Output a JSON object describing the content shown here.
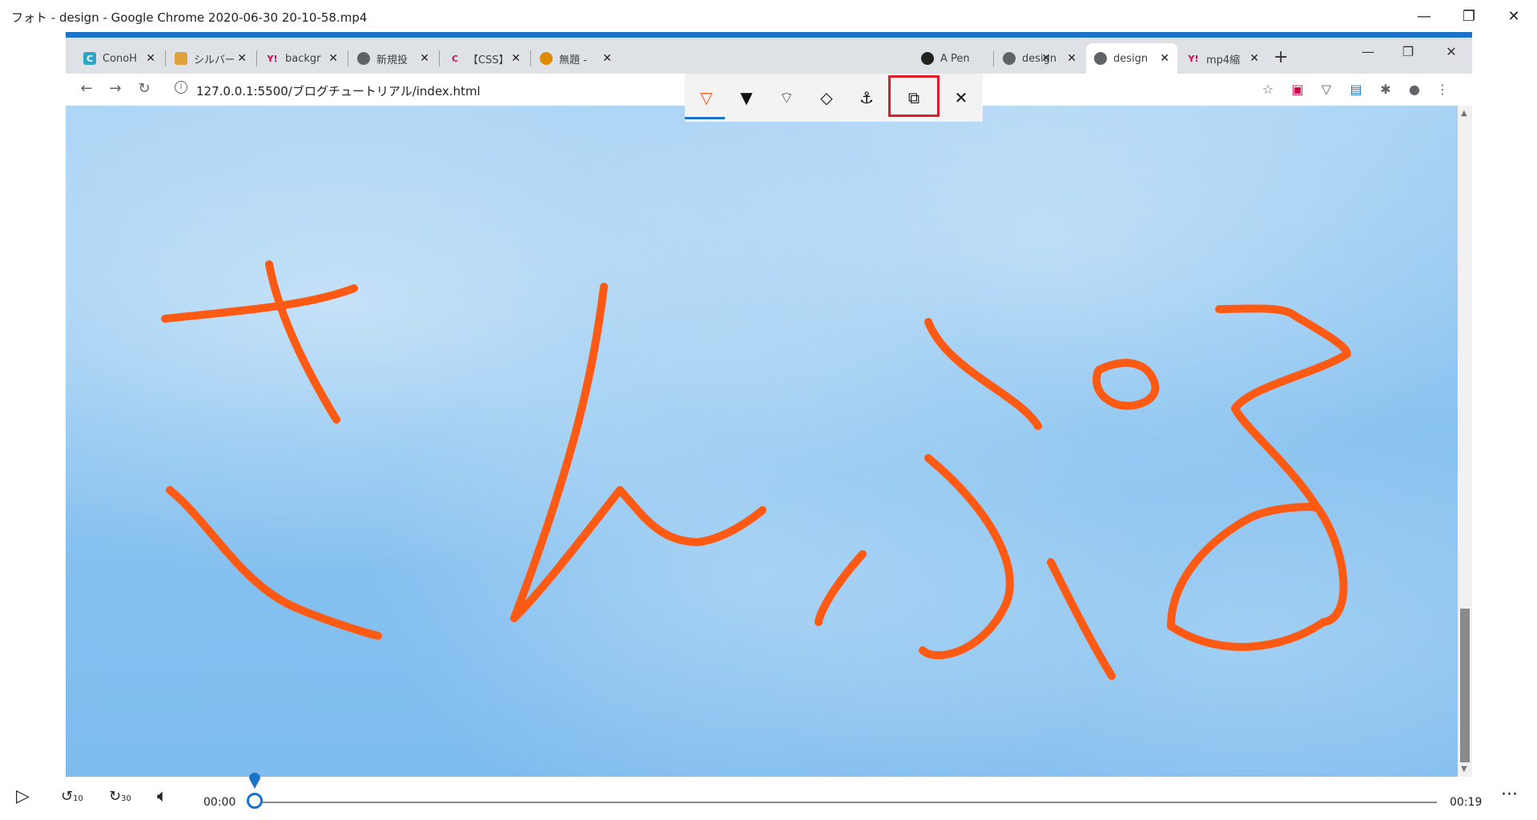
{
  "player": {
    "title": "フォト - design - Google Chrome 2020-06-30 20-10-58.mp4",
    "minimize_glyph": "—",
    "restore_glyph": "❐",
    "close_glyph": "✕"
  },
  "browser": {
    "tabs": [
      {
        "label": "ConoH",
        "favicon": "C",
        "favicon_color": "#2aa6c9"
      },
      {
        "label": "シルバー",
        "favicon": "",
        "favicon_color": "#e0a23a"
      },
      {
        "label": "backgr",
        "favicon": "Y!",
        "favicon_color": "#d6004c"
      },
      {
        "label": "新規投",
        "favicon": "",
        "favicon_color": "#5f6368"
      },
      {
        "label": "【CSS】",
        "favicon": "C",
        "favicon_color": "#c2185b"
      },
      {
        "label": "無題 -",
        "favicon": "",
        "favicon_color": "#e08a00"
      },
      {
        "label": "A Pen",
        "favicon": "",
        "favicon_color": "#222"
      },
      {
        "label": "design",
        "favicon": "",
        "favicon_color": "#5f6368"
      },
      {
        "label": "design",
        "favicon": "",
        "favicon_color": "#5f6368",
        "active": true
      },
      {
        "label": "mp4縮",
        "favicon": "Y!",
        "favicon_color": "#d6004c"
      }
    ],
    "new_tab_glyph": "+",
    "url": "127.0.0.1:5500/ブログチュートリアル/index.html",
    "accent_color": "#1a73c9"
  },
  "ink_toolbar": {
    "tools": [
      {
        "name": "ballpoint-pen",
        "glyph": "▽"
      },
      {
        "name": "pencil",
        "glyph": "▼"
      },
      {
        "name": "calligraphy-pen",
        "glyph": "⌔"
      },
      {
        "name": "eraser",
        "glyph": "◇"
      },
      {
        "name": "anchor",
        "glyph": "⚓"
      },
      {
        "name": "save",
        "glyph": "⧉"
      },
      {
        "name": "close",
        "glyph": "✕"
      }
    ],
    "highlight_color": "#e0192a"
  },
  "drawing": {
    "stroke_color": "#ff5a14"
  },
  "playback": {
    "time_current": "00:00",
    "time_total": "00:19",
    "skip_back_label": "10",
    "skip_forward_label": "30",
    "progress": 0,
    "more_glyph": "···"
  }
}
